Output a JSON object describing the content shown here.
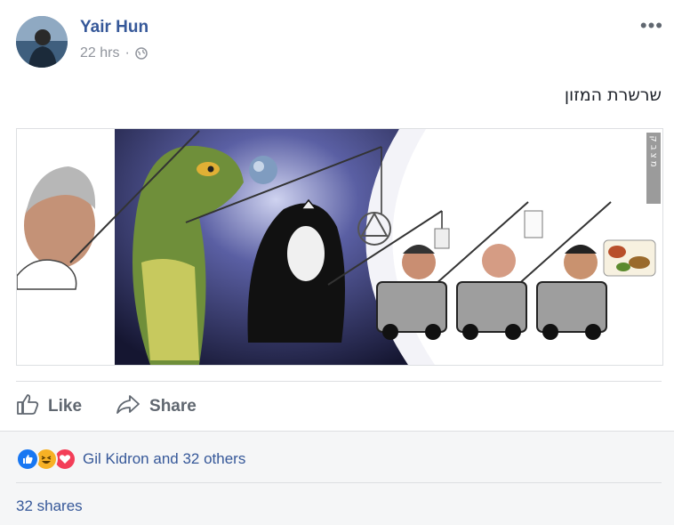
{
  "post": {
    "author": "Yair Hun",
    "time": "22 hrs",
    "separator": "·",
    "text": "שרשרת המזון",
    "more_icon": "more-dots-icon",
    "privacy_icon": "globe-icon"
  },
  "image": {
    "side_label": "מ  צ  ב  ק  ש"
  },
  "actions": {
    "like_label": "Like",
    "share_label": "Share"
  },
  "footer": {
    "reactions_text": "Gil Kidron and 32 others",
    "shares_text": "32 shares"
  },
  "colors": {
    "link": "#365899",
    "muted": "#90949c",
    "like_blue": "#1877f2",
    "haha_yellow": "#f7b125",
    "love_red": "#f33e58"
  }
}
